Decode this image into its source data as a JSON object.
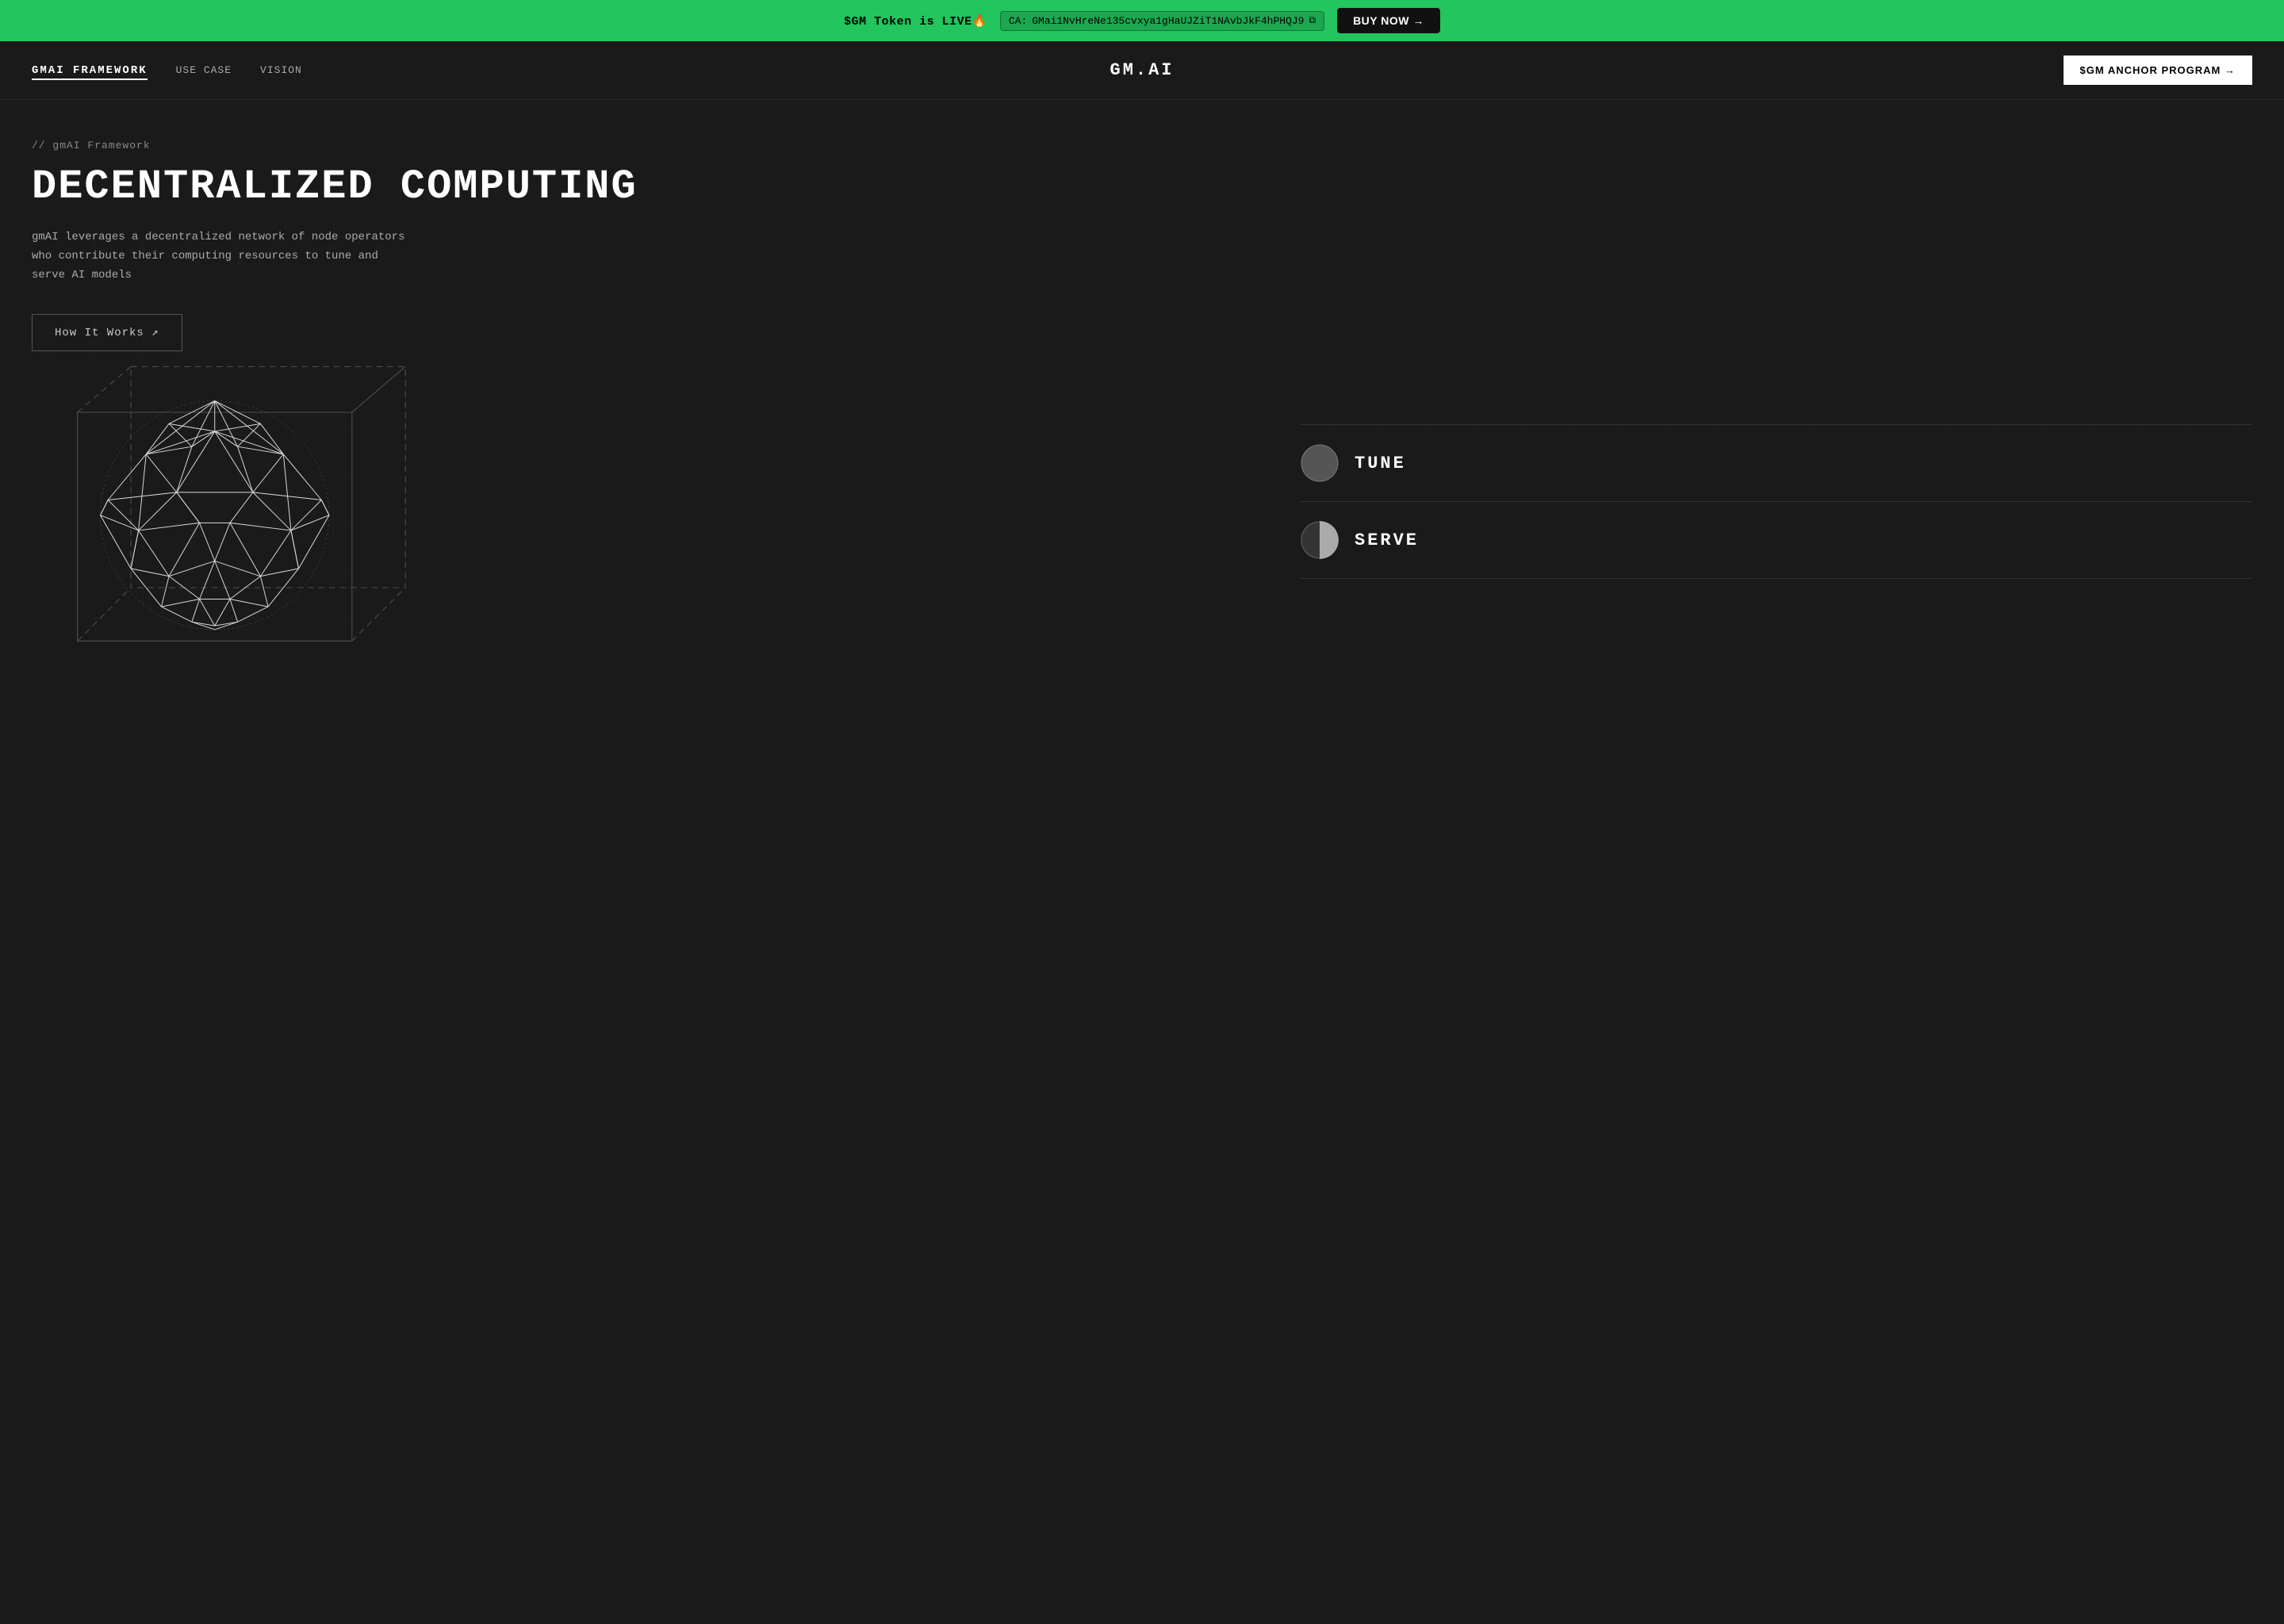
{
  "banner": {
    "token_text": "$GM Token is LIVE🔥",
    "ca_label": "CA:",
    "ca_address": "GMai1NvHreNe135cvxya1gHaUJZiT1NAvbJkF4hPHQJ9",
    "buy_now_label": "BUY NOW →"
  },
  "nav": {
    "brand": "GMAI FRAMEWORK",
    "links": [
      "USE CASE",
      "VISION"
    ],
    "logo": "GM.AI",
    "anchor_btn": "$GM ANCHOR PROGRAM →"
  },
  "hero": {
    "breadcrumb": "// gmAI Framework",
    "title": "DECENTRALIZED COMPUTING",
    "description": "gmAI leverages a decentralized network of node operators who contribute their computing resources to tune and serve AI models",
    "how_it_works": "How It Works ↗"
  },
  "features": [
    {
      "id": "tune",
      "label": "TUNE"
    },
    {
      "id": "serve",
      "label": "SERVE"
    }
  ],
  "colors": {
    "green": "#22c55e",
    "bg": "#1a1a1a",
    "text_muted": "#888888"
  }
}
